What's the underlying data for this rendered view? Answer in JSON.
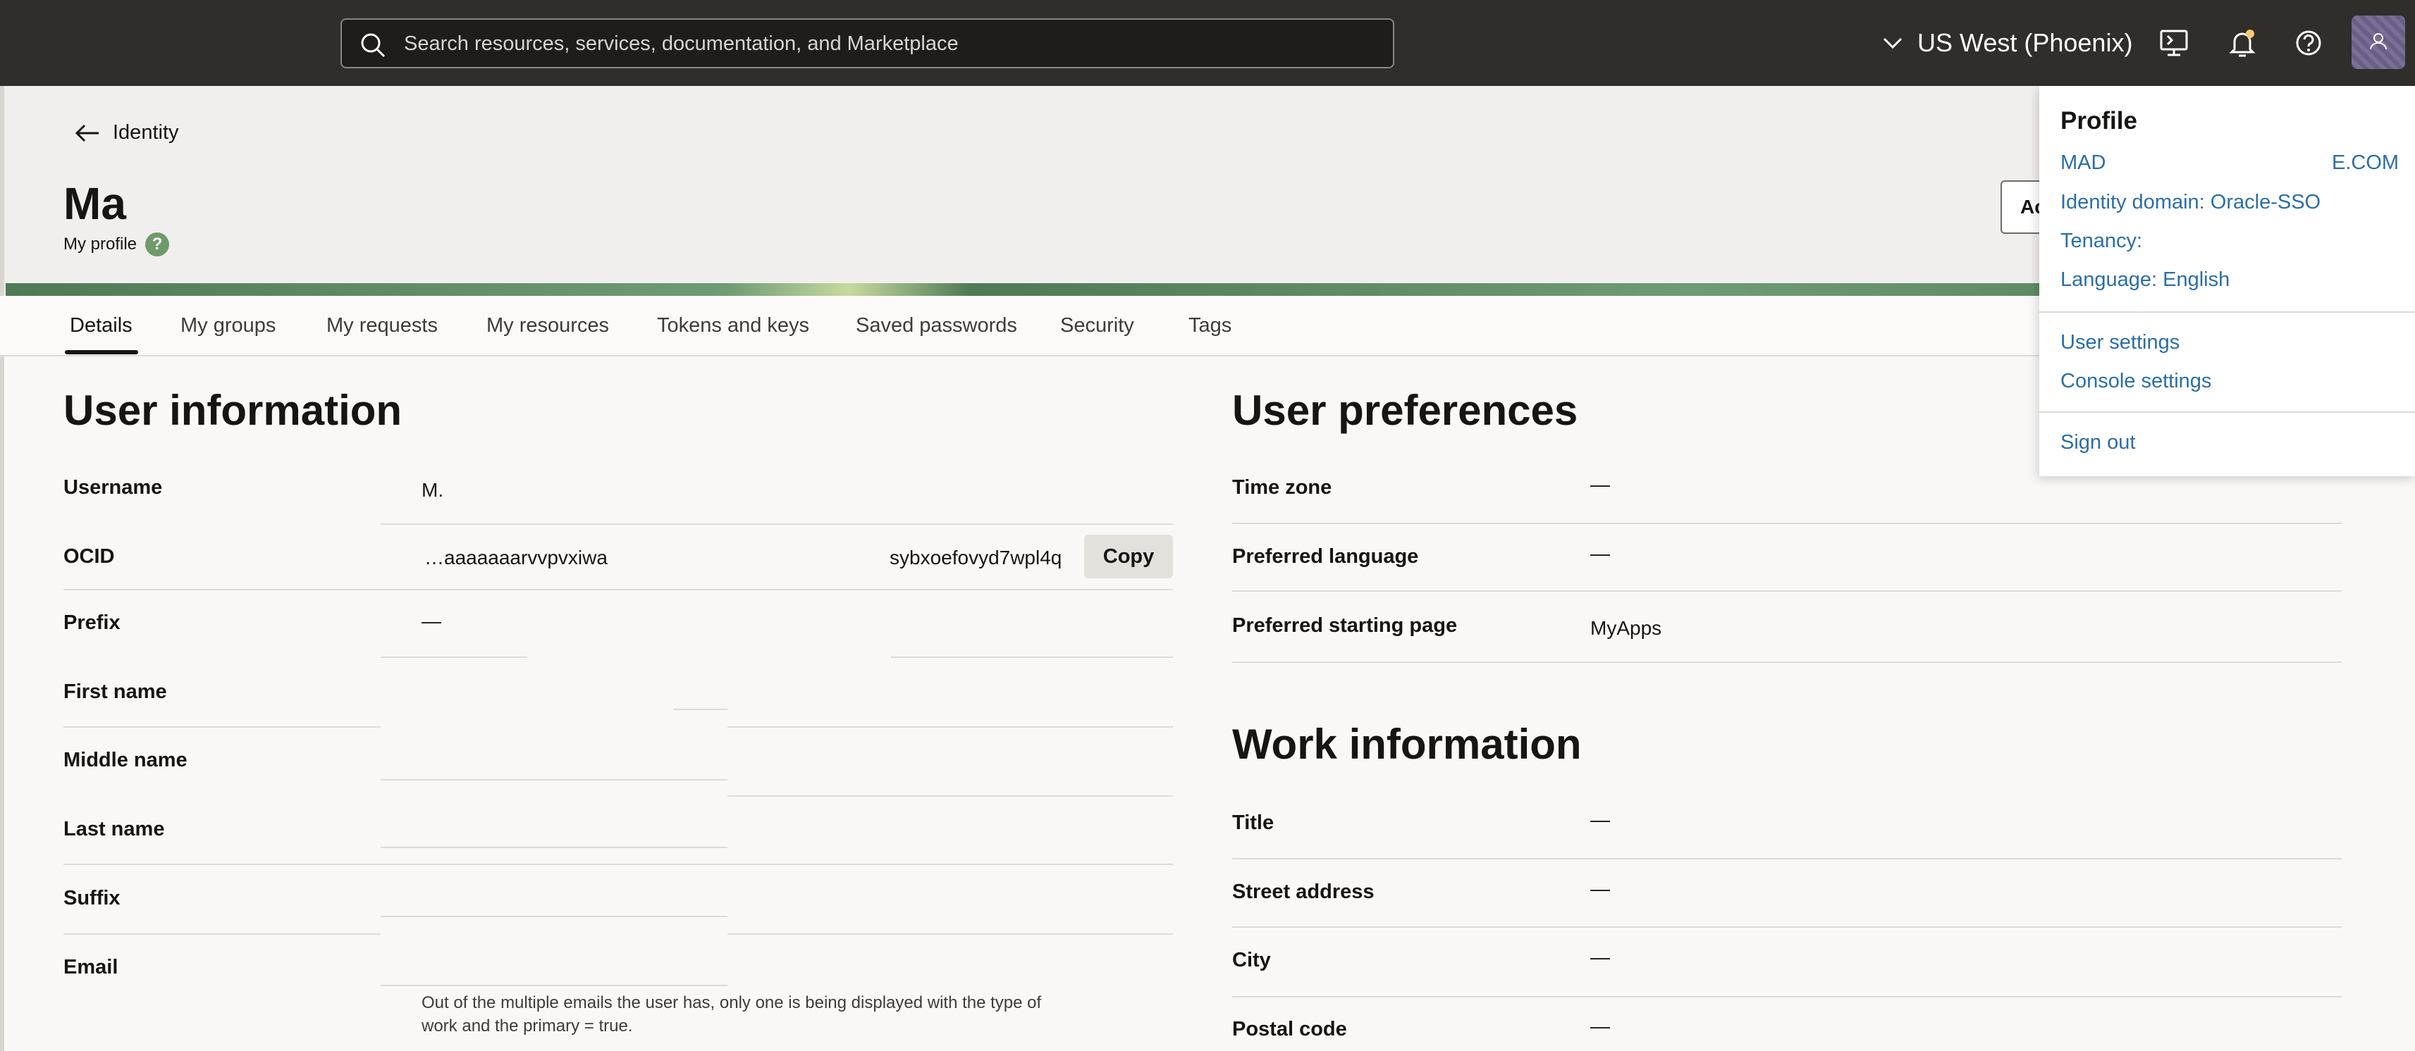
{
  "topbar": {
    "search_placeholder": "Search resources, services, documentation, and Marketplace",
    "region_label": "US West (Phoenix)",
    "icons": [
      "search-icon",
      "chevron-down-icon",
      "cloud-shell-icon",
      "bell-icon",
      "help-icon",
      "avatar"
    ]
  },
  "header": {
    "back_label": "Identity",
    "page_title": "Ma",
    "page_subtitle": "My profile",
    "help_glyph": "?",
    "actions_label": "Ac"
  },
  "tabs": [
    "Details",
    "My groups",
    "My requests",
    "My resources",
    "Tokens and keys",
    "Saved passwords",
    "Security",
    "Tags"
  ],
  "user_information": {
    "title": "User information",
    "username_label": "Username",
    "username_value": "M.",
    "ocid_label": "OCID",
    "ocid_short": "…aaaaaaarvvpvxiwa",
    "ocid_tail": "sybxoefovyd7wpl4q",
    "copy_label": "Copy",
    "prefix_label": "Prefix",
    "prefix_value": "—",
    "first_name_label": "First name",
    "middle_name_label": "Middle name",
    "last_name_label": "Last name",
    "suffix_label": "Suffix",
    "email_label": "Email",
    "email_note": "Out of the multiple emails the user has, only one is being displayed with the type of work and the primary = true."
  },
  "user_preferences": {
    "title": "User preferences",
    "time_zone_label": "Time zone",
    "time_zone_value": "—",
    "language_label": "Preferred language",
    "language_value": "—",
    "starting_page_label": "Preferred starting page",
    "starting_page_value": "MyApps"
  },
  "work_information": {
    "title": "Work information",
    "title_label": "Title",
    "title_value": "—",
    "street_label": "Street address",
    "street_value": "—",
    "city_label": "City",
    "city_value": "—",
    "postal_label": "Postal code",
    "postal_value": "—"
  },
  "profile_menu": {
    "title": "Profile",
    "user_name": "MAD",
    "user_tail": "E.COM",
    "identity_domain": "Identity domain: Oracle-SSO",
    "tenancy": "Tenancy:",
    "language": "Language: English",
    "user_settings": "User settings",
    "console_settings": "Console settings",
    "sign_out": "Sign out"
  },
  "colors": {
    "topbar": "#312d2a",
    "link": "#2b6ea5",
    "banner_green": "#4e7a55"
  }
}
